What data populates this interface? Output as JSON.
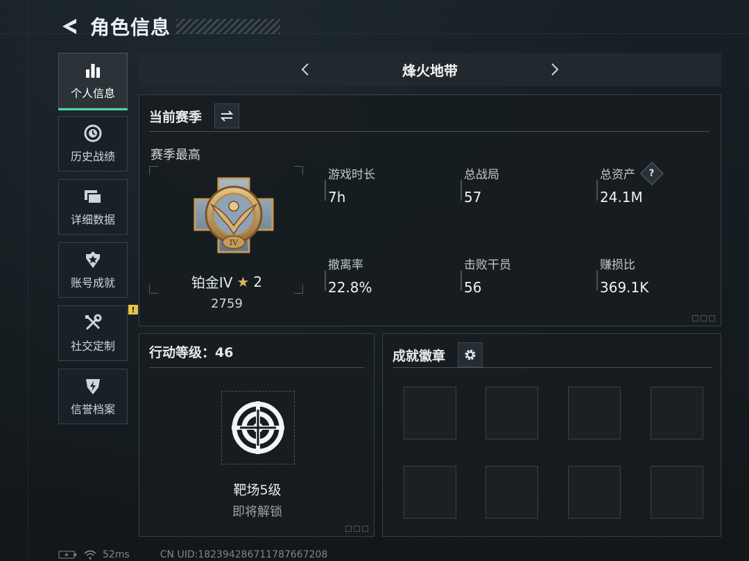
{
  "header": {
    "title": "角色信息"
  },
  "sidebar": {
    "items": [
      {
        "label": "个人信息",
        "icon": "bar-chart-icon",
        "active": true
      },
      {
        "label": "历史战绩",
        "icon": "history-icon"
      },
      {
        "label": "详细数据",
        "icon": "folder-icon"
      },
      {
        "label": "账号成就",
        "icon": "achievement-icon"
      },
      {
        "label": "社交定制",
        "icon": "tools-icon",
        "badge": "!"
      },
      {
        "label": "信誉档案",
        "icon": "credit-shield-icon"
      }
    ]
  },
  "mode": {
    "title": "烽火地带"
  },
  "season": {
    "title": "当前赛季",
    "best_label": "赛季最高",
    "rank_name": "铂金IV",
    "rank_star": "★",
    "rank_stars": "2",
    "rank_score": "2759",
    "stats": [
      {
        "label": "游戏时长",
        "value": "7h"
      },
      {
        "label": "总战局",
        "value": "57"
      },
      {
        "label": "总资产",
        "value": "24.1M",
        "help": "?"
      },
      {
        "label": "撤离率",
        "value": "22.8%"
      },
      {
        "label": "击败干员",
        "value": "56"
      },
      {
        "label": "赚损比",
        "value": "369.1K"
      }
    ]
  },
  "level": {
    "title": "行动等级：46",
    "unlock_name": "靶场5级",
    "unlock_status": "即将解锁"
  },
  "badges": {
    "title": "成就徽章"
  },
  "status": {
    "ping": "52ms",
    "uid": "CN UID:1823942867117876672​08"
  },
  "colors": {
    "accent": "#48d6a2",
    "warning": "#e8c34a",
    "gold": "#d9b866"
  }
}
